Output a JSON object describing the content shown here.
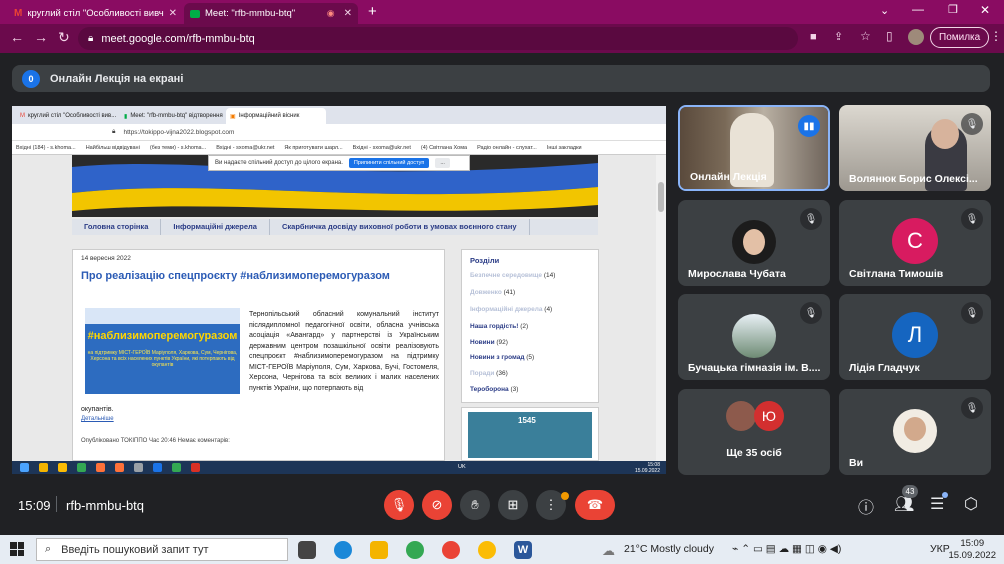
{
  "browser": {
    "tabs": [
      {
        "title": "круглий стіл \"Особливості вивч",
        "icon": "gmail-icon"
      },
      {
        "title": "Meet: \"rfb-mmbu-btq\"",
        "icon": "meet-icon"
      }
    ],
    "url": "meet.google.com/rfb-mmbu-btq",
    "profile_button": "Помилка"
  },
  "meet": {
    "presenter_count": "0",
    "presentation_title": "Онлайн Лекція на екрані",
    "time": "15:09",
    "meeting_code": "rfb-mmbu-btq",
    "participants_count": "43",
    "participants": [
      {
        "name": "Онлайн Лекція",
        "muted": false,
        "speaking": true,
        "type": "photo"
      },
      {
        "name": "Волянюк Борис Олексі...",
        "muted": true,
        "type": "photo"
      },
      {
        "name": "Мирослава Чубата",
        "muted": true,
        "type": "photo"
      },
      {
        "name": "Світлана Тимошів",
        "muted": true,
        "type": "avatar",
        "initial": "С",
        "color": "#d81b60"
      },
      {
        "name": "Бучацька гімназія ім. В....",
        "muted": true,
        "type": "photo"
      },
      {
        "name": "Лідія Гладчук",
        "muted": true,
        "type": "avatar",
        "initial": "Л",
        "color": "#1565c0"
      },
      {
        "name": "Ще 35 осіб",
        "muted": false,
        "type": "group",
        "initial": "Ю",
        "color": "#d32f2f"
      },
      {
        "name": "Ви",
        "muted": true,
        "type": "photo"
      }
    ]
  },
  "shared_screen": {
    "tabs": [
      "круглий стіл \"Особливості вив...",
      "Meet: \"rfb-mmbu-btq\" відтворення",
      "Інформаційний вісник"
    ],
    "url": "https://tokippo-vijna2022.blogspot.com",
    "bookmarks": [
      "Вхідні (184) - s.khoma...",
      "Найбільш відвідувані",
      "(без теми) - s.khoma...",
      "Вхідні - sxoma@ukr.net",
      "Як приготувати шарл...",
      "Вхідні - sxoma@ukr.net",
      "(4) Світлана Хома",
      "Радіо онлайн - слухат...",
      "Інші закладки"
    ],
    "share_notice": "Ви надаєте спільний доступ до цілого екрана.",
    "share_stop": "Припинити спільний доступ",
    "share_hide": "...",
    "nav": [
      "Головна сторінка",
      "Інформаційні джерела",
      "Скарбничка досвіду виховної роботи в умовах воєнного стану"
    ],
    "post": {
      "date": "14 вересня 2022",
      "title": "Про реалізацію спецпроєкту #наблизимоперемогуразом",
      "promo_heading": "#наблизимоперемогуразом",
      "promo_sub": "на підтримку МІСТ-ГЕРОЇВ Маріуполя, Харкова, Сум, Чернігова, Херсона та всіх населених пунктів України, які потерпають від окупантів",
      "body": "Тернопільський обласний комунальний інститут післядипломної педагогічної освіти, обласна учнівська асоціація «Авангард» у партнерстві із Українським державним центром позашкільної освіти реалізовують спецпроєкт #наблизимоперемогуразом на підтримку МІСТ-ГЕРОЇВ Маріуполя, Сум, Харкова, Бучі, Гостомеля, Херсона, Чернігова та всіх великих і малих населених пунктів України, що потерпають від",
      "body_end": "окупантів.",
      "more": "Детальніше",
      "footer": "Опубліковано ТОКІППО Час 20:46    Немає коментарів:"
    },
    "sidebar": {
      "heading": "Розділи",
      "items": [
        {
          "label": "Безпечне середовище",
          "count": "(14)",
          "faded": true
        },
        {
          "label": "Довженко",
          "count": "(41)",
          "faded": true
        },
        {
          "label": "Інформаційні джерела",
          "count": "(4)",
          "faded": true
        },
        {
          "label": "Наша гордість!",
          "count": "(2)",
          "faded": false
        },
        {
          "label": "Новини",
          "count": "(92)",
          "faded": false
        },
        {
          "label": "Новини з громад",
          "count": "(5)",
          "faded": false
        },
        {
          "label": "Поради",
          "count": "(36)",
          "faded": true
        },
        {
          "label": "Тероборона",
          "count": "(3)",
          "faded": false
        }
      ],
      "widget_label": "1545"
    },
    "taskbar_time": "15:08",
    "taskbar_date": "15.09.2022",
    "taskbar_lang": "UK"
  },
  "windows_taskbar": {
    "search_placeholder": "Введіть пошуковий запит тут",
    "weather": "21°C  Mostly cloudy",
    "lang": "УКР",
    "time": "15:09",
    "date": "15.09.2022"
  }
}
